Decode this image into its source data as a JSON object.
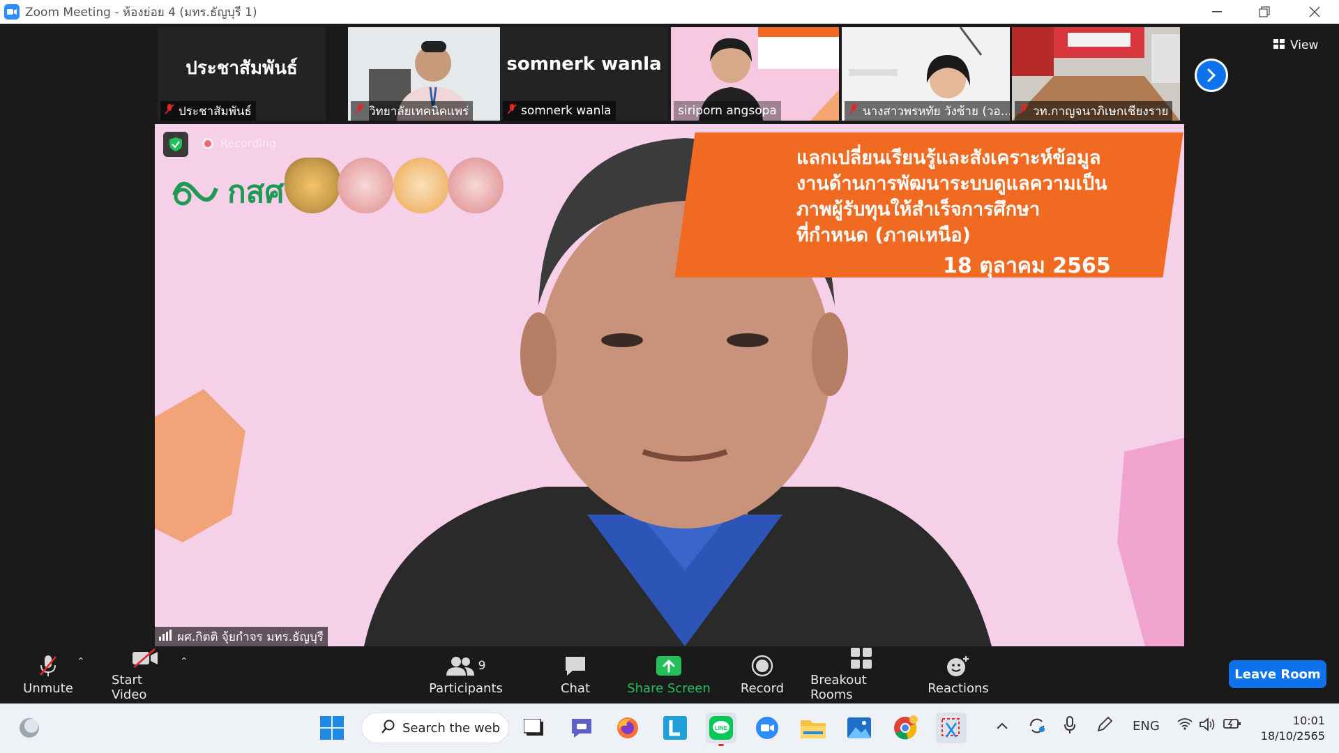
{
  "window": {
    "title": "Zoom Meeting - ห้องย่อย 4 (มทร.ธัญบุรี 1)"
  },
  "gallery": {
    "tiles": [
      {
        "display": "ประชาสัมพันธ์",
        "caption": "ประชาสัมพันธ์",
        "type": "name"
      },
      {
        "display": "",
        "caption": "วิทยาลัยเทคนิคแพร่",
        "type": "video"
      },
      {
        "display": "somnerk wanla",
        "caption": "somnerk wanla",
        "type": "name"
      },
      {
        "display": "",
        "caption": "siriporn angsopa",
        "type": "video"
      },
      {
        "display": "",
        "caption": "นางสาวพรหทัย วังซ้าย (วอ...",
        "type": "video"
      },
      {
        "display": "",
        "caption": "วท.กาญจนาภิเษกเชียงราย",
        "type": "video"
      }
    ],
    "view_label": "View"
  },
  "main_video": {
    "recording_label": "Recording",
    "logo_text": "กสศ",
    "banner_lines": [
      "แลกเปลี่ยนเรียนรู้และสังเคราะห์ข้อมูล",
      "งานด้านการพัฒนาระบบดูแลความเป็น",
      "ภาพผู้รับทุนให้สำเร็จการศึกษา",
      "ที่กำหนด (ภาคเหนือ)"
    ],
    "banner_date": "18 ตุลาคม 2565",
    "speaker_name": "ผศ.กิตติ จุ้ยกำจร มทร.ธัญบุรี"
  },
  "toolbar": {
    "unmute": "Unmute",
    "start_video": "Start Video",
    "participants": "Participants",
    "participants_count": "9",
    "chat": "Chat",
    "share_screen": "Share Screen",
    "record": "Record",
    "breakout_rooms": "Breakout Rooms",
    "reactions": "Reactions",
    "leave_room": "Leave Room"
  },
  "taskbar": {
    "search_placeholder": "Search the web",
    "language": "ENG",
    "time": "10:01",
    "date": "18/10/2565"
  },
  "colors": {
    "accent": "#0e72ed",
    "share_green": "#23c05a",
    "banner_orange": "#f06a21",
    "mic_red": "#e02828"
  }
}
